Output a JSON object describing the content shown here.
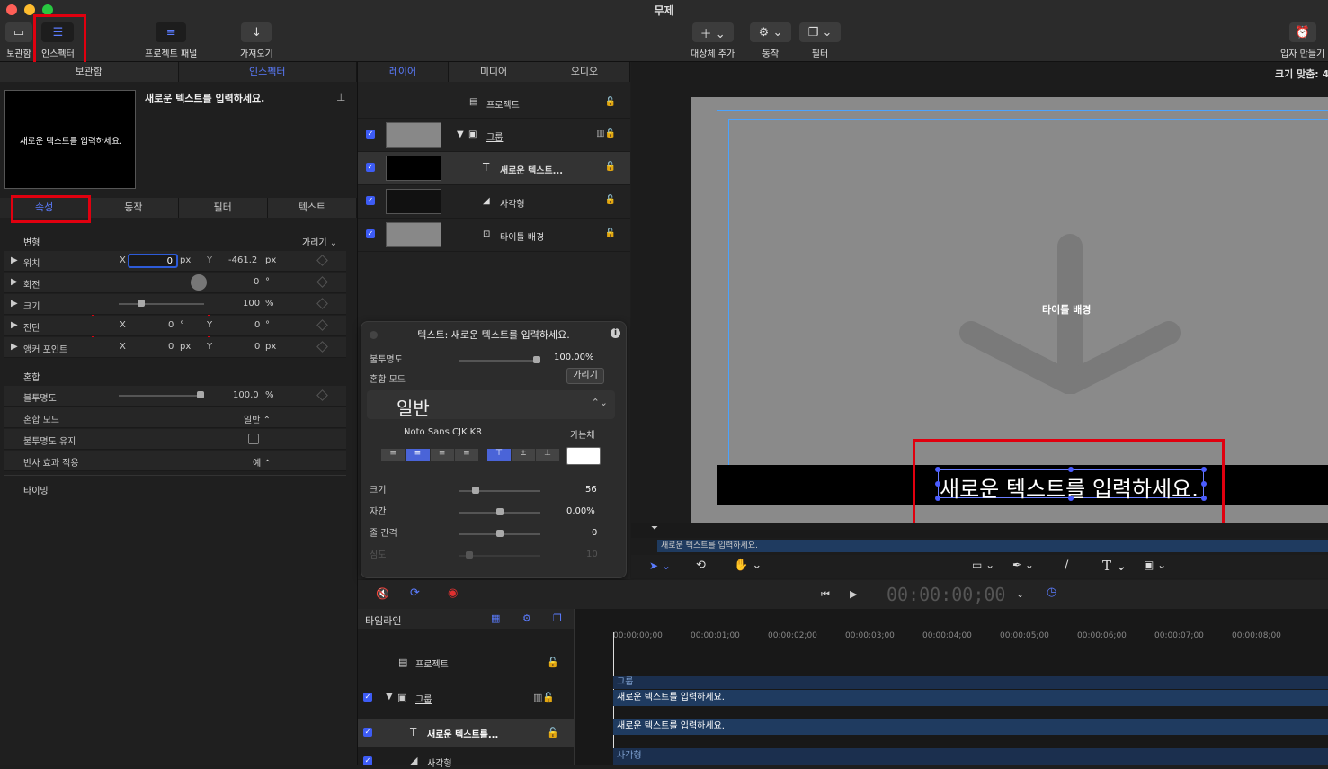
{
  "window": {
    "title": "무제"
  },
  "toolbar": {
    "library": "보관함",
    "inspector": "인스펙터",
    "project_panel": "프로젝트 패널",
    "import": "가져오기",
    "add_object": "대상체 추가",
    "behaviors": "동작",
    "filters": "필터",
    "make_particles": "입자 만들기"
  },
  "colors": {
    "accent": "#5b7cff",
    "highlight_box": "#e0000f",
    "clip": "#1f3b60",
    "canvas_guide": "#4aa3ff"
  },
  "left": {
    "top_tabs": [
      "보관함",
      "인스펙터"
    ],
    "preview_text": "새로운 텍스트를 입력하세요.",
    "preview_title": "새로운 텍스트를 입력하세요.",
    "sub_tabs": [
      "속성",
      "동작",
      "필터",
      "텍스트"
    ],
    "transform": {
      "title": "변형",
      "hide": "가리기",
      "position": {
        "label": "위치",
        "x_label": "X",
        "x": "0",
        "x_unit": "px",
        "y_label": "Y",
        "y": "-461.2",
        "y_unit": "px"
      },
      "rotation": {
        "label": "회전",
        "value": "0",
        "unit": "°"
      },
      "scale": {
        "label": "크기",
        "value": "100",
        "unit": "%"
      },
      "shear": {
        "label": "전단",
        "x_label": "X",
        "x": "0",
        "x_unit": "°",
        "y_label": "Y",
        "y": "0",
        "y_unit": "°"
      },
      "anchor": {
        "label": "앵커 포인트",
        "x_label": "X",
        "x": "0",
        "x_unit": "px",
        "y_label": "Y",
        "y": "0",
        "y_unit": "px"
      }
    },
    "blend": {
      "title": "혼합",
      "opacity": {
        "label": "불투명도",
        "value": "100.0",
        "unit": "%"
      },
      "mode": {
        "label": "혼합 모드",
        "value": "일반"
      },
      "preserve": {
        "label": "불투명도 유지"
      },
      "reflection": {
        "label": "반사 효과 적용",
        "value": "예"
      }
    },
    "timing": {
      "title": "타이밍"
    }
  },
  "layers": {
    "tabs": [
      "레이어",
      "미디어",
      "오디오"
    ],
    "project": "프로젝트",
    "items": [
      {
        "name": "그룹"
      },
      {
        "name": "새로운 텍스트..."
      },
      {
        "name": "사각형"
      },
      {
        "name": "타이틀 배경"
      }
    ]
  },
  "hud": {
    "title": "텍스트: 새로운 텍스트를 입력하세요.",
    "opacity_label": "불투명도",
    "opacity_value": "100.00%",
    "blend_label": "혼합 모드",
    "hide": "가리기",
    "mode_value": "일반",
    "font": "Noto Sans CJK KR",
    "weight": "가는체",
    "size_label": "크기",
    "size_value": "56",
    "tracking_label": "자간",
    "tracking_value": "0.00%",
    "line_label": "줄 간격",
    "line_value": "0",
    "depth_label": "심도",
    "depth_value": "10"
  },
  "canvas": {
    "fit": "크기 맞춤: 4",
    "title_bg_label": "타이틀 배경",
    "text": "새로운 텍스트를 입력하세요.",
    "mini_clip": "새로운 텍스트를 입력하세요."
  },
  "transport": {
    "timecode": "00:00:00;00"
  },
  "timeline": {
    "title": "타임라인",
    "ruler": [
      "00:00:00;00",
      "00:00:01;00",
      "00:00:02;00",
      "00:00:03;00",
      "00:00:04;00",
      "00:00:05;00",
      "00:00:06;00",
      "00:00:07;00",
      "00:00:08;00"
    ],
    "rows": {
      "project": "프로젝트",
      "group": "그룹",
      "text": "새로운 텍스트를...",
      "rect": "사각형"
    },
    "clips": {
      "group": "그룹",
      "text1": "새로운 텍스트를 입력하세요.",
      "text2": "새로운 텍스트를 입력하세요.",
      "rect": "사각형"
    }
  }
}
